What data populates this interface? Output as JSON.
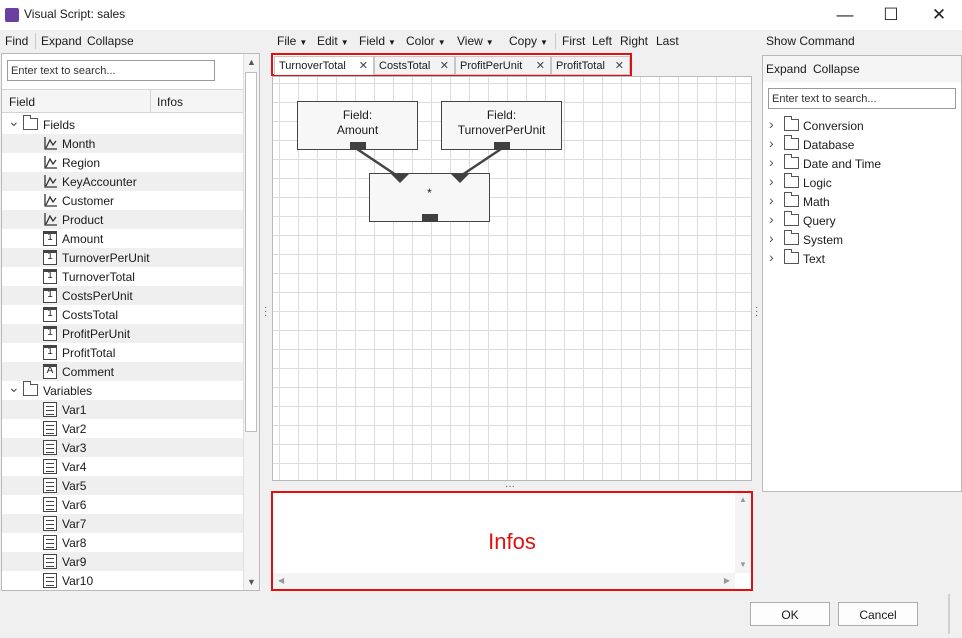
{
  "window": {
    "title": "Visual Script: sales",
    "minimize_glyph": "—",
    "maximize_glyph": "☐",
    "close_glyph": "✕"
  },
  "left_panel": {
    "find_label": "Find",
    "expand_label": "Expand",
    "collapse_label": "Collapse",
    "search_placeholder": "Enter text to search...",
    "columns": [
      "Field",
      "Infos"
    ],
    "groups": [
      {
        "name": "Fields",
        "items": [
          {
            "label": "Month",
            "icon": "dimension-icon"
          },
          {
            "label": "Region",
            "icon": "dimension-icon"
          },
          {
            "label": "KeyAccounter",
            "icon": "dimension-icon"
          },
          {
            "label": "Customer",
            "icon": "dimension-icon"
          },
          {
            "label": "Product",
            "icon": "dimension-icon"
          },
          {
            "label": "Amount",
            "icon": "numeric-field-icon"
          },
          {
            "label": "TurnoverPerUnit",
            "icon": "numeric-field-icon"
          },
          {
            "label": "TurnoverTotal",
            "icon": "numeric-field-icon"
          },
          {
            "label": "CostsPerUnit",
            "icon": "numeric-field-icon"
          },
          {
            "label": "CostsTotal",
            "icon": "numeric-field-icon"
          },
          {
            "label": "ProfitPerUnit",
            "icon": "numeric-field-icon"
          },
          {
            "label": "ProfitTotal",
            "icon": "numeric-field-icon"
          },
          {
            "label": "Comment",
            "icon": "text-field-icon"
          }
        ]
      },
      {
        "name": "Variables",
        "items": [
          {
            "label": "Var1"
          },
          {
            "label": "Var2"
          },
          {
            "label": "Var3"
          },
          {
            "label": "Var4"
          },
          {
            "label": "Var5"
          },
          {
            "label": "Var6"
          },
          {
            "label": "Var7"
          },
          {
            "label": "Var8"
          },
          {
            "label": "Var9"
          },
          {
            "label": "Var10"
          }
        ]
      }
    ],
    "numeric_glyph": "1",
    "text_glyph": "A"
  },
  "menu": {
    "items": [
      {
        "label": "File",
        "dropdown": true
      },
      {
        "label": "Edit",
        "dropdown": true
      },
      {
        "label": "Field",
        "dropdown": true
      },
      {
        "label": "Color",
        "dropdown": true
      },
      {
        "label": "View",
        "dropdown": true
      },
      {
        "label": "Copy",
        "dropdown": true
      },
      {
        "label": "First",
        "dropdown": false
      },
      {
        "label": "Left",
        "dropdown": false
      },
      {
        "label": "Right",
        "dropdown": false
      },
      {
        "label": "Last",
        "dropdown": false
      }
    ]
  },
  "tabs": [
    {
      "label": "TurnoverTotal",
      "active": true
    },
    {
      "label": "CostsTotal",
      "active": false
    },
    {
      "label": "ProfitPerUnit",
      "active": false
    },
    {
      "label": "ProfitTotal",
      "active": false
    }
  ],
  "tab_close_glyph": "✕",
  "canvas": {
    "nodes": [
      {
        "line1": "Field:",
        "line2": "Amount"
      },
      {
        "line1": "Field:",
        "line2": "TurnoverPerUnit"
      },
      {
        "line1": "*",
        "line2": ""
      }
    ]
  },
  "infos": {
    "label": "Infos"
  },
  "right_panel": {
    "show_command_label": "Show Command",
    "expand_label": "Expand",
    "collapse_label": "Collapse",
    "search_placeholder": "Enter text to search...",
    "categories": [
      "Conversion",
      "Database",
      "Date and Time",
      "Logic",
      "Math",
      "Query",
      "System",
      "Text"
    ]
  },
  "footer": {
    "ok_label": "OK",
    "cancel_label": "Cancel"
  },
  "colors": {
    "highlight": "#e01010",
    "app_icon": "#6b3fa0"
  }
}
